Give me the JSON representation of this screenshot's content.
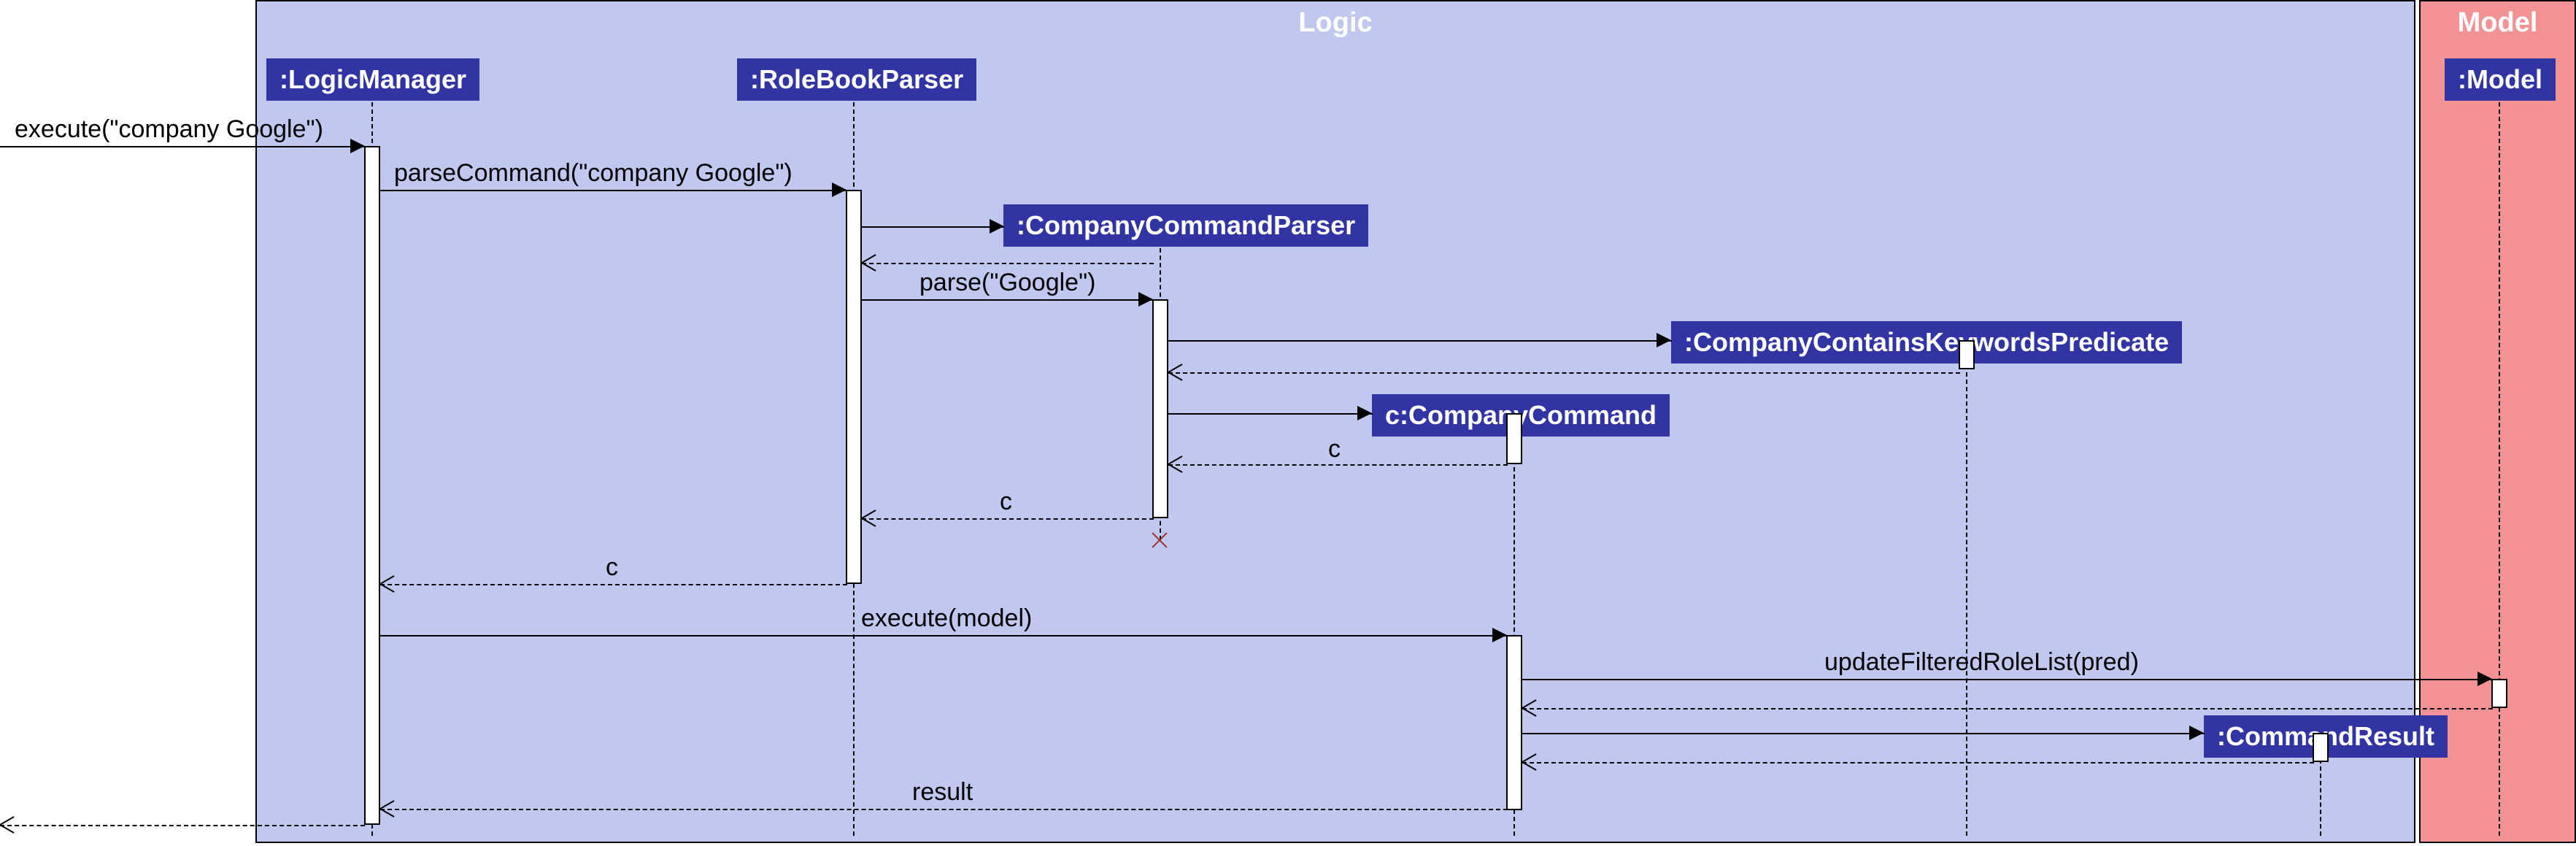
{
  "frames": {
    "logic_title": "Logic",
    "model_title": "Model"
  },
  "participants": {
    "logicManager": ":LogicManager",
    "roleBookParser": ":RoleBookParser",
    "companyCommandParser": ":CompanyCommandParser",
    "predicate": ":CompanyContainsKeywordsPredicate",
    "companyCommand": "c:CompanyCommand",
    "commandResult": ":CommandResult",
    "model": ":Model"
  },
  "messages": {
    "execute_call": "execute(\"company Google\")",
    "parseCommand": "parseCommand(\"company Google\")",
    "parse": "parse(\"Google\")",
    "return_c1": "c",
    "return_c2": "c",
    "return_c3": "c",
    "executeModel": "execute(model)",
    "updateFiltered": "updateFilteredRoleList(pred)",
    "result": "result"
  }
}
